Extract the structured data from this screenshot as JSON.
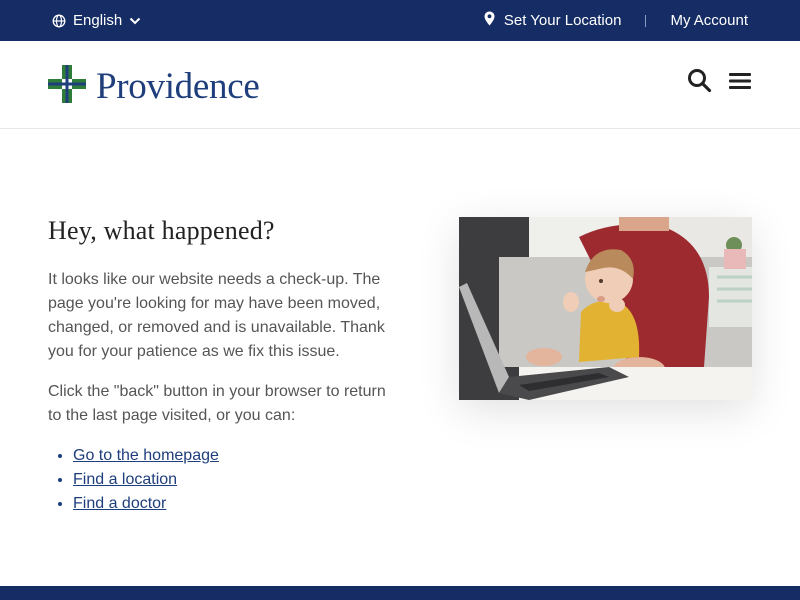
{
  "utility_bar": {
    "language": "English",
    "set_location": "Set Your Location",
    "separator": "|",
    "account": "My Account",
    "background_color": "#152d64"
  },
  "header": {
    "logo_text": "Providence",
    "logo_colors": [
      "#2f7d3a",
      "#1f3e7c"
    ],
    "icons": [
      "search-icon",
      "menu-icon"
    ]
  },
  "main": {
    "title": "Hey, what happened?",
    "paragraph_1": "It looks like our website needs a check-up. The page you're looking for may have been moved, changed, or removed and is unavailable. Thank you for your patience as we fix this issue.",
    "paragraph_2": "Click the \"back\" button in your browser to return to the last page visited, or you can:",
    "links": [
      {
        "label": "Go to the homepage"
      },
      {
        "label": "Find a location"
      },
      {
        "label": "Find a doctor"
      }
    ]
  },
  "image": {
    "subject": "toddler-and-parent-at-laptop"
  },
  "theme": {
    "navy": "#152d64",
    "link_blue": "#1f3e7c"
  }
}
